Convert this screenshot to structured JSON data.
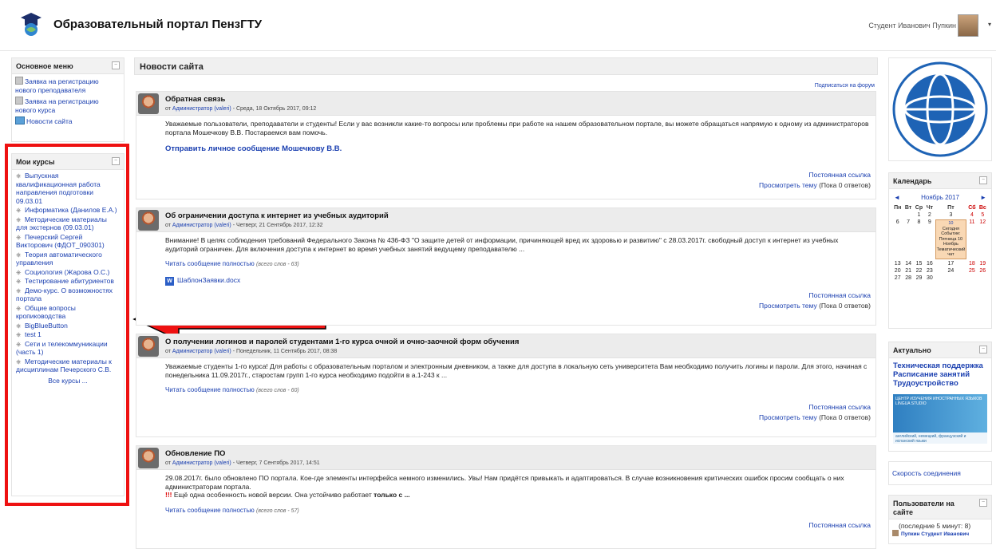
{
  "header": {
    "site_title": "Образовательный портал ПензГТУ",
    "user_name": "Студент Иванович Пупкин",
    "user_caret": "▾"
  },
  "main_menu": {
    "title": "Основное меню",
    "items": [
      {
        "label": "Заявка на регистрацию нового преподавателя"
      },
      {
        "label": "Заявка на регистрацию нового курса"
      },
      {
        "label": "Новости сайта"
      }
    ]
  },
  "my_courses": {
    "title": "Мои курсы",
    "courses": [
      "Выпускная квалификационная работа направления подготовки 09.03.01",
      "Информатика (Данилов Е.А.)",
      "Методические материалы для экстернов (09.03.01)",
      "Печерский Сергей Викторович (ФДОТ_090301)",
      "Теория автоматического управления",
      "Социология (Жарова О.С.)",
      "Тестирование абитуриентов",
      "Демо-курс. О возможностях портала",
      "Общие вопросы кропиководства",
      "BigBlueButton",
      "test 1",
      "Сети и телекоммуникации (часть 1)",
      "Методические материалы к дисциплинам Печерского С.В."
    ],
    "all_courses": "Все курсы ..."
  },
  "main": {
    "title": "Новости сайта",
    "subscribe": "Подписаться на форум",
    "posts": [
      {
        "subject": "Обратная связь",
        "meta_prefix": "от",
        "author": "Администратор (valeri)",
        "date": "- Среда, 18 Октябрь 2017, 09:12",
        "body": "Уважаемые пользователи, преподаватели и студенты! Если у вас возникли какие-то вопросы или проблемы при работе на нашем образовательном портале, вы можете обращаться напрямую к одному из администраторов портала Мошечкову В.В. Постараемся вам помочь.",
        "link": "Отправить личное сообщение Мошечкову В.В.",
        "permalink": "Постоянная ссылка",
        "discuss": "Просмотреть тему",
        "replies": "(Пока 0 ответов)"
      },
      {
        "subject": "Об ограничении доступа к интернет из учебных аудиторий",
        "meta_prefix": "от",
        "author": "Администратор (valeri)",
        "date": "- Четверг, 21 Сентябрь 2017, 12:32",
        "body": "Внимание! В целях соблюдения требований Федерального Закона № 436-ФЗ \"О защите детей от информации, причиняющей вред их здоровью и развитию\" с 28.03.2017г. свободный доступ к интернет из учебных аудиторий ограничен. Для включения доступа к интернет во время учебных занятий ведущему преподавателю ...",
        "read_more": "Читать сообщение полностью",
        "words": "(всего слов - 63)",
        "attachment": "ШаблонЗаявки.docx",
        "doc_icon": "W",
        "permalink": "Постоянная ссылка",
        "discuss": "Просмотреть тему",
        "replies": "(Пока 0 ответов)"
      },
      {
        "subject": "О получении логинов и паролей студентами 1-го курса очной и очно-заочной форм обучения",
        "meta_prefix": "от",
        "author": "Администратор (valeri)",
        "date": "- Понедельник, 11 Сентябрь 2017, 08:38",
        "body": "Уважаемые студенты 1-го курса! Для работы с образовательным порталом и электронным дневником, а также для доступа в локальную сеть университета Вам необходимо получить логины и пароли. Для этого, начиная с понедельника 11.09.2017г., старостам групп 1-го курса необходимо подойти в а.1-243 к ...",
        "read_more": "Читать сообщение полностью",
        "words": "(всего слов - 60)",
        "permalink": "Постоянная ссылка",
        "discuss": "Просмотреть тему",
        "replies": "(Пока 0 ответов)"
      },
      {
        "subject": "Обновление ПО",
        "meta_prefix": "от",
        "author": "Администратор (valeri)",
        "date": "- Четверг, 7 Сентябрь 2017, 14:51",
        "body": "29.08.2017г. было обновлено ПО портала. Кое-где элементы интерфейса немного изменились. Увы! Нам придётся привыкать и адаптироваться. В случае возникновения критических ошибок просим сообщать о них администраторам портала.",
        "excl": "!!!",
        "body2": "Ещё одна особенность новой версии. Она устойчиво работает",
        "body2_bold": "только с ...",
        "read_more": "Читать сообщение полностью",
        "words": "(всего слов - 57)",
        "permalink": "Постоянная ссылка"
      }
    ]
  },
  "calendar": {
    "title": "Календарь",
    "month": "Ноябрь 2017",
    "prev": "◄",
    "next": "►",
    "dows": [
      "Пн",
      "Вт",
      "Ср",
      "Чт",
      "Пт",
      "Сб",
      "Вс"
    ],
    "rows": [
      [
        "",
        "",
        "1",
        "2",
        "3",
        "4",
        "5"
      ],
      [
        "6",
        "7",
        "8",
        "9",
        "",
        "11",
        "12"
      ],
      [
        "13",
        "14",
        "15",
        "16",
        "17",
        "18",
        "19"
      ],
      [
        "20",
        "21",
        "22",
        "23",
        "24",
        "25",
        "26"
      ],
      [
        "27",
        "28",
        "29",
        "30",
        "",
        "",
        ""
      ]
    ],
    "today_num": "10",
    "today_label": "Сегодня",
    "event_text": "Событие: Пятница 10 Ноябрь",
    "event_tag": "Тематический чат"
  },
  "actual": {
    "title": "Актуально",
    "links": [
      "Техническая поддержка",
      "Расписание занятий",
      "Трудоустройство"
    ],
    "banner_top": "ЦЕНТР ИЗУЧЕНИЯ ИНОСТРАННЫХ ЯЗЫКОВ LINGUA STUDIO",
    "banner_bottom": "английский, немецкий, французский и испанский языки"
  },
  "speed": {
    "label": "Скорость соединения"
  },
  "online": {
    "title": "Пользователи на сайте",
    "sub": "(последние 5 минут: 8)",
    "user": "Пупкин Студент Иванович"
  },
  "colors": {
    "frame": "#ee1111",
    "arrow": "#ee1111",
    "link": "#1a3fb0"
  }
}
